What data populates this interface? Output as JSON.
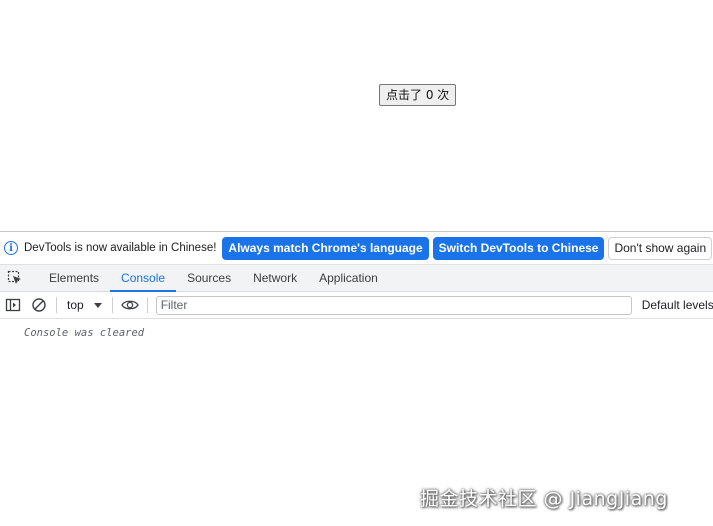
{
  "page": {
    "counter_button": "点击了 0 次"
  },
  "infobar": {
    "message": "DevTools is now available in Chinese!",
    "match_language_button": "Always match Chrome's language",
    "switch_button": "Switch DevTools to Chinese",
    "dismiss_button": "Don't show again"
  },
  "tabs": [
    {
      "label": "Elements"
    },
    {
      "label": "Console"
    },
    {
      "label": "Sources"
    },
    {
      "label": "Network"
    },
    {
      "label": "Application"
    }
  ],
  "active_tab": "Console",
  "console_toolbar": {
    "context": "top",
    "filter_placeholder": "Filter",
    "levels": "Default levels"
  },
  "console": {
    "message": "Console was cleared"
  },
  "watermark": "掘金技术社区 @ JiangJiang",
  "colors": {
    "accent": "#1a73e8",
    "tab_bar_bg": "#f1f3f4"
  },
  "icons": {
    "info": "info-icon",
    "inspect": "inspect-element-icon",
    "sidebar": "sidebar-toggle-icon",
    "clear": "clear-console-icon",
    "live_expression": "eye-icon"
  }
}
